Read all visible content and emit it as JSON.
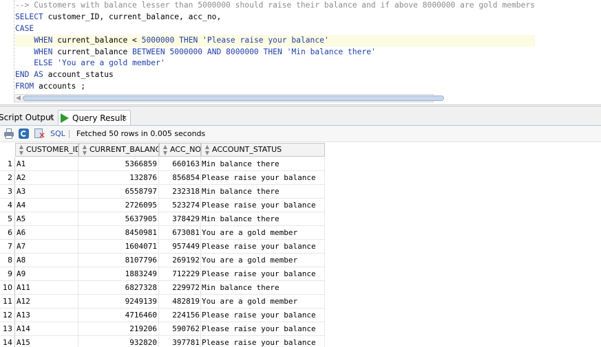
{
  "editor": {
    "lines": [
      [
        {
          "t": "--> Customers with balance lesser than 5000000 should raise their balance and if above 8000000 are gold members",
          "c": "cm"
        }
      ],
      [
        {
          "t": "SELECT",
          "c": "kw"
        },
        {
          "t": " customer_ID, current_balance, acc_no,",
          "c": "plain"
        }
      ],
      [
        {
          "t": "CASE",
          "c": "kw"
        }
      ],
      [
        {
          "t": "    ",
          "c": "plain"
        },
        {
          "t": "WHEN",
          "c": "kw"
        },
        {
          "t": " current_balance < ",
          "c": "plain"
        },
        {
          "t": "5000000",
          "c": "num"
        },
        {
          "t": " ",
          "c": "plain"
        },
        {
          "t": "THEN",
          "c": "kw"
        },
        {
          "t": " ",
          "c": "plain"
        },
        {
          "t": "'Please raise your balance'",
          "c": "str"
        }
      ],
      [
        {
          "t": "    ",
          "c": "plain"
        },
        {
          "t": "WHEN",
          "c": "kw"
        },
        {
          "t": " current_balance ",
          "c": "plain"
        },
        {
          "t": "BETWEEN",
          "c": "kw"
        },
        {
          "t": " ",
          "c": "plain"
        },
        {
          "t": "5000000",
          "c": "num"
        },
        {
          "t": " ",
          "c": "plain"
        },
        {
          "t": "AND",
          "c": "kw"
        },
        {
          "t": " ",
          "c": "plain"
        },
        {
          "t": "8000000",
          "c": "num"
        },
        {
          "t": " ",
          "c": "plain"
        },
        {
          "t": "THEN",
          "c": "kw"
        },
        {
          "t": " ",
          "c": "plain"
        },
        {
          "t": "'Min balance there'",
          "c": "str"
        }
      ],
      [
        {
          "t": "    ",
          "c": "plain"
        },
        {
          "t": "ELSE",
          "c": "kw"
        },
        {
          "t": " ",
          "c": "plain"
        },
        {
          "t": "'You are a gold member'",
          "c": "str"
        }
      ],
      [
        {
          "t": "END",
          "c": "kw"
        },
        {
          "t": " ",
          "c": "plain"
        },
        {
          "t": "AS",
          "c": "kw"
        },
        {
          "t": " account_status",
          "c": "plain"
        }
      ],
      [
        {
          "t": "FROM",
          "c": "kw"
        },
        {
          "t": " accounts ;",
          "c": "plain"
        }
      ]
    ],
    "highlighted_line": 3
  },
  "tabs": {
    "script_output": "Script Output",
    "query_result": "Query Result",
    "close_glyph": "×"
  },
  "toolbar": {
    "sql_label": "SQL",
    "separator": "|",
    "status": "Fetched 50 rows in 0.005 seconds"
  },
  "grid": {
    "columns": [
      "CUSTOMER_ID",
      "CURRENT_BALANCE",
      "ACC_NO",
      "ACCOUNT_STATUS"
    ],
    "rows": [
      {
        "n": "1",
        "id": "A1",
        "bal": "5366859",
        "acc": "660163",
        "status": "Min balance there"
      },
      {
        "n": "2",
        "id": "A2",
        "bal": "132876",
        "acc": "856854",
        "status": "Please raise your balance"
      },
      {
        "n": "3",
        "id": "A3",
        "bal": "6558797",
        "acc": "232318",
        "status": "Min balance there"
      },
      {
        "n": "4",
        "id": "A4",
        "bal": "2726095",
        "acc": "523274",
        "status": "Please raise your balance"
      },
      {
        "n": "5",
        "id": "A5",
        "bal": "5637905",
        "acc": "378429",
        "status": "Min balance there"
      },
      {
        "n": "6",
        "id": "A6",
        "bal": "8450981",
        "acc": "673081",
        "status": "You are a gold member"
      },
      {
        "n": "7",
        "id": "A7",
        "bal": "1604071",
        "acc": "957449",
        "status": "Please raise your balance"
      },
      {
        "n": "8",
        "id": "A8",
        "bal": "8107796",
        "acc": "269192",
        "status": "You are a gold member"
      },
      {
        "n": "9",
        "id": "A9",
        "bal": "1883249",
        "acc": "712229",
        "status": "Please raise your balance"
      },
      {
        "n": "10",
        "id": "A11",
        "bal": "6827328",
        "acc": "229972",
        "status": "Min balance there"
      },
      {
        "n": "11",
        "id": "A12",
        "bal": "9249139",
        "acc": "482819",
        "status": "You are a gold member"
      },
      {
        "n": "12",
        "id": "A13",
        "bal": "4716460",
        "acc": "224156",
        "status": "Please raise your balance"
      },
      {
        "n": "13",
        "id": "A14",
        "bal": "219206",
        "acc": "590762",
        "status": "Please raise your balance"
      },
      {
        "n": "14",
        "id": "A15",
        "bal": "932820",
        "acc": "397781",
        "status": "Please raise your balance"
      }
    ]
  },
  "icons": {
    "print": "print-icon",
    "refresh": "refresh-icon",
    "cancel": "cancel-query-icon",
    "run": "play-icon",
    "sort": "sort-arrows-icon"
  }
}
